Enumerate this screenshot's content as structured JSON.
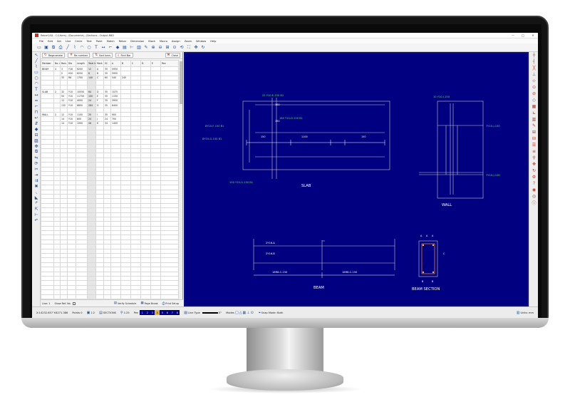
{
  "window": {
    "title": "RebarCAD - C:\\Users\\...\\Documents\\...\\Sections - Output.RBD",
    "minimize": "—",
    "maximize": "□",
    "close": "✕"
  },
  "menu": [
    "File",
    "Edit",
    "Set",
    "Line",
    "Circle",
    "Text",
    "Point",
    "Match",
    "Rebar",
    "Dimension",
    "Block",
    "Macro",
    "Assign",
    "Zoom",
    "Window",
    "Help"
  ],
  "toolbar_icons": [
    "open-icon",
    "save-icon",
    "copy-icon",
    "print-icon",
    "line-icon",
    "polyline-icon",
    "arc-icon",
    "circle-icon",
    "text-icon",
    "dimension-icon",
    "rebar-icon",
    "bar-mark-icon",
    "schedule-icon",
    "measure-icon",
    "layer-icon",
    "pen-icon",
    "zoom-in-icon",
    "zoom-out-icon",
    "zoom-window-icon",
    "zoom-all-icon",
    "zoom-previous-icon",
    "zoom-extents-icon",
    "pan-icon",
    "redraw-icon"
  ],
  "panel": {
    "tabs": [
      "Regenerate",
      "Re-number",
      "Sort bars",
      "Find Bar",
      "Close"
    ],
    "columns": [
      "Member",
      "No. mbrs",
      "Bars in each",
      "Dia",
      "Length",
      "Total length",
      "Mark",
      "SC",
      "A",
      "B",
      "C",
      "D",
      "E",
      "Rev"
    ],
    "rows": [
      [
        "BEAM",
        "4",
        "3",
        "Y16",
        "6200",
        "12",
        "A",
        "35",
        "5950",
        "",
        "",
        "",
        "",
        ""
      ],
      [
        "",
        "",
        "2",
        "H20",
        "6250",
        "8",
        "B",
        "35",
        "5950",
        "",
        "",
        "",
        "",
        ""
      ],
      [
        "",
        "",
        "35",
        "R8",
        "1700",
        "140",
        "C",
        "60",
        "540",
        "240",
        "",
        "",
        "",
        ""
      ],
      [
        "",
        "",
        "",
        "",
        "",
        "",
        "",
        "",
        "",
        "",
        "",
        "",
        "",
        ""
      ],
      [
        "",
        "",
        "",
        "",
        "",
        "",
        "",
        "",
        "",
        "",
        "",
        "",
        "",
        ""
      ],
      [
        "SLAB",
        "2",
        "32",
        "Y10",
        "10550",
        "64",
        "D",
        "35",
        "1575",
        "",
        "",
        "",
        "",
        ""
      ],
      [
        "",
        "",
        "50",
        "Y10",
        "11750",
        "100",
        "E",
        "35",
        "1150",
        "",
        "",
        "",
        "",
        ""
      ],
      [
        "",
        "",
        "12",
        "Y10",
        "4000",
        "24",
        "F",
        "35",
        "3950",
        "",
        "",
        "",
        "",
        ""
      ],
      [
        "",
        "",
        "132",
        "Y10",
        "8850",
        "264",
        "G",
        "35",
        "8400",
        "",
        "",
        "",
        "",
        ""
      ],
      [
        "",
        "",
        "",
        "",
        "",
        "",
        "",
        "",
        "",
        "",
        "",
        "",
        "",
        ""
      ],
      [
        "WALL",
        "2",
        "12",
        "Y10",
        "1100",
        "20",
        "I",
        "35",
        "900",
        "",
        "",
        "",
        "",
        ""
      ],
      [
        "",
        "",
        "14",
        "Y10",
        "800",
        "24",
        "J",
        "24",
        "700",
        "",
        "",
        "",
        "",
        ""
      ],
      [
        "",
        "",
        "14",
        "Y10",
        "1500",
        "28",
        "K",
        "34",
        "1400",
        "",
        "",
        "",
        "",
        ""
      ]
    ],
    "blank_rows": 40,
    "footer": {
      "line": "Line: 1",
      "show_ref": "Show Ref. No.",
      "verify": "Verify Schedule",
      "page_break": "Page Break",
      "print_setup": "Print Setup"
    }
  },
  "drawing": {
    "slab": {
      "label": "SLAB",
      "callouts": [
        "22 Y10-E-150 B1",
        "8Y10-F-150 B1",
        "8Y10-G-150 B1",
        "100 Y10-G-150 B1",
        "160 Y10-D-150 B1"
      ],
      "dims": [
        "150",
        "1100",
        "150",
        "100",
        "150"
      ]
    },
    "wall": {
      "label": "WALL",
      "callouts": [
        "10 Y10-I-150",
        "7Y10-J-150",
        "7Y10-J-100"
      ]
    },
    "beam": {
      "label": "BEAM",
      "callouts": [
        "2Y16-A",
        "2Y16-B",
        "18R8-C-150",
        "18R8-C-150"
      ]
    },
    "beam_section": {
      "label": "BEAM SECTION",
      "tags": [
        "A",
        "A",
        "A",
        "B",
        "B",
        "C"
      ]
    }
  },
  "status": {
    "coords": "X:14232.657  Y:8271.386",
    "points_label": "Points",
    "points_value": "0",
    "scale": "1:2",
    "layer": "SECTIONS",
    "zoom": "1:25",
    "pen_label": "Pen",
    "pens": [
      "1",
      "2",
      "3",
      "4",
      "5",
      "6",
      "7",
      "8"
    ],
    "selected_pen": "4",
    "line_type_label": "Line Type",
    "line_type_value": "0°",
    "modes_label": "Modes",
    "snap_mode": "Snap Mode: Both",
    "units": "Units: mm"
  },
  "colors": {
    "canvas": "#000080",
    "drawing_lines": "#c8c8c8",
    "dims": "#ffffff",
    "callouts": "#5de05d",
    "rebar": "#ff9030"
  }
}
